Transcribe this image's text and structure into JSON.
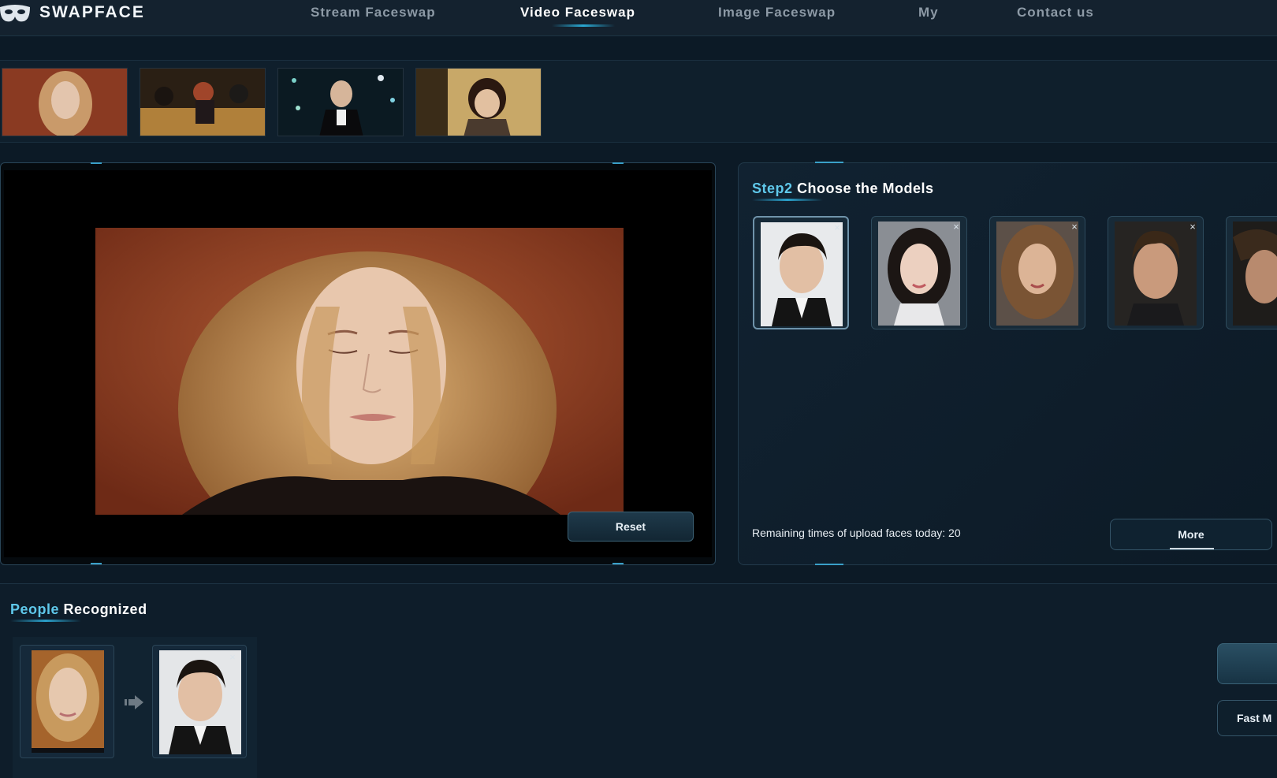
{
  "brand": {
    "name": "SWAPFACE"
  },
  "nav": {
    "items": [
      {
        "label": "Stream Faceswap"
      },
      {
        "label": "Video Faceswap"
      },
      {
        "label": "Image Faceswap"
      },
      {
        "label": "My"
      },
      {
        "label": "Contact us"
      }
    ],
    "active_index": 1
  },
  "video": {
    "reset_label": "Reset"
  },
  "models": {
    "title_highlight": "Step2",
    "title_main": "Choose the Models",
    "remaining_text": "Remaining times of upload faces today: 20",
    "more_label": "More",
    "close_glyph": "×"
  },
  "people": {
    "title_highlight": "People",
    "title_main": "Recognized",
    "close_glyph": "×"
  },
  "side": {
    "fast_label": "Fast M"
  },
  "colors": {
    "accent": "#5fc8ea",
    "background": "#0c1a26",
    "panel_border": "#2a4659"
  }
}
